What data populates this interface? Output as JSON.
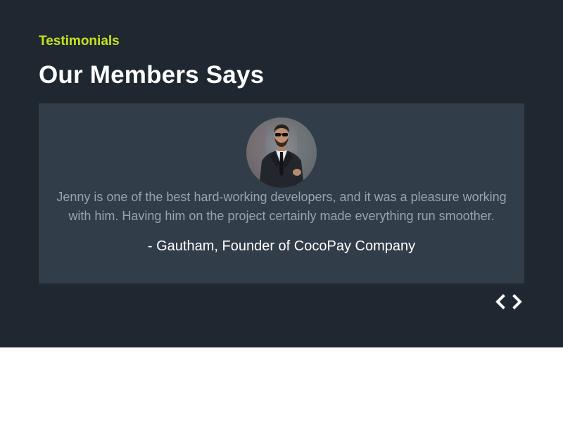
{
  "section": {
    "eyebrow": "Testimonials",
    "title": "Our Members Says"
  },
  "testimonial": {
    "quote": "Jenny is one of the best hard-working developers, and it was a pleasure working with him. Having him on the project certainly made everything run smoother.",
    "author": "- Gautham, Founder of CocoPay Company",
    "avatar_icon": "man-in-suit-avatar"
  },
  "navigation": {
    "prev_icon": "chevron-left-icon",
    "next_icon": "chevron-right-icon"
  },
  "colors": {
    "section_background": "#1f2731",
    "card_background": "#323d4a",
    "accent": "#c8e31c",
    "heading": "#ffffff",
    "quote_text": "#9aa3ad",
    "page_background": "#ffffff"
  }
}
